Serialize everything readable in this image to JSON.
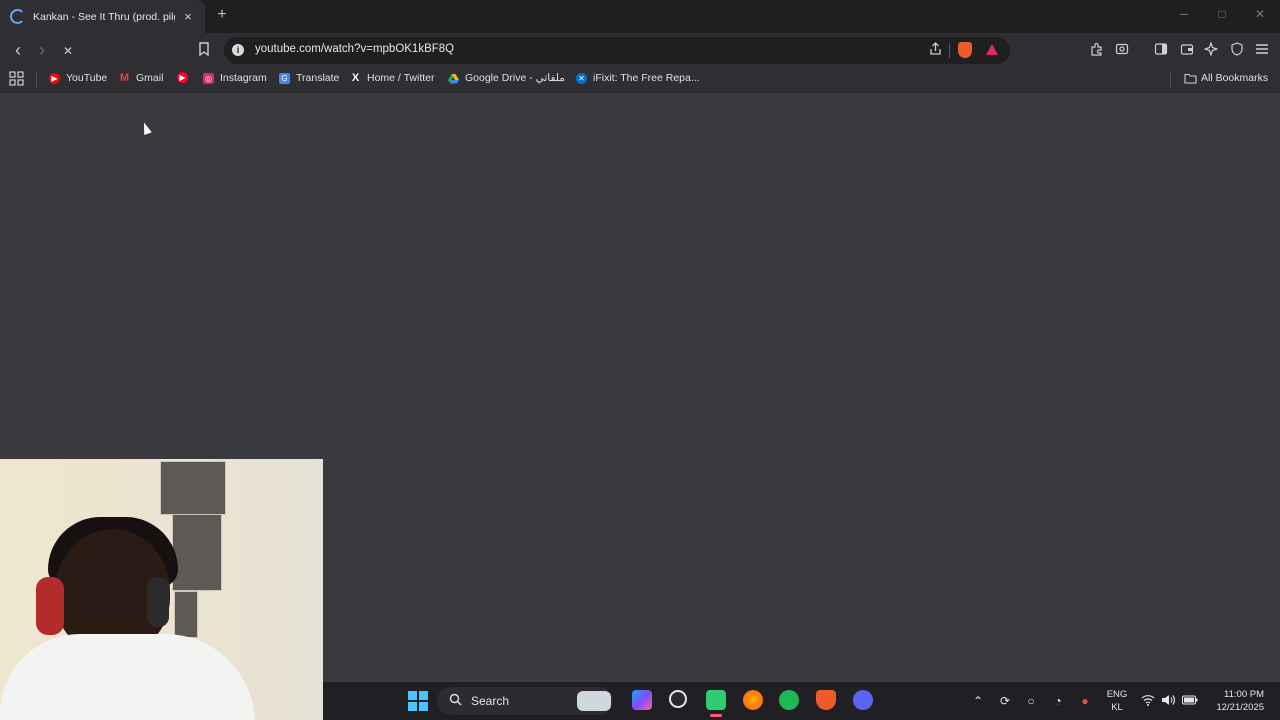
{
  "browser": {
    "tab": {
      "title": "Kankan - See It Thru (prod. pilgri",
      "close": "×"
    },
    "new_tab": "+",
    "window_controls": {
      "minimize": "─",
      "maximize": "□",
      "close": "✕"
    },
    "address": {
      "url": "youtube.com/watch?v=mpbOK1kBF8Q",
      "info_icon": "i"
    },
    "nav": {
      "back": "‹",
      "forward": "›",
      "stop": "✕"
    },
    "bookmarks": [
      {
        "label": "YouTube",
        "icon": "youtube-icon",
        "color": "#ff0000"
      },
      {
        "label": "Gmail",
        "icon": "gmail-icon",
        "color": "#ea4335"
      },
      {
        "label": "",
        "icon": "youtube-music-icon",
        "color": "#ff0033"
      },
      {
        "label": "Instagram",
        "icon": "instagram-icon",
        "color": "#d62976"
      },
      {
        "label": "Translate",
        "icon": "translate-icon",
        "color": "#4285f4"
      },
      {
        "label": "Home / Twitter",
        "icon": "x-icon",
        "color": "#000000"
      },
      {
        "label": "Google Drive - ملفاتي",
        "icon": "google-drive-icon",
        "color": "#1fa463"
      },
      {
        "label": "iFixit: The Free Repa...",
        "icon": "ifixit-icon",
        "color": "#0071ce"
      }
    ],
    "all_bookmarks": "All Bookmarks"
  },
  "taskbar": {
    "search_label": "Search",
    "language": {
      "line1": "ENG",
      "line2": "KL"
    },
    "clock": {
      "time": "11:00 PM",
      "date": "12/21/2025"
    }
  },
  "colors": {
    "page_bg": "#3a3a3f",
    "chrome_bg": "#2f2f33",
    "tabstrip_bg": "#1f1f22",
    "taskbar_bg": "#202024",
    "brave_orange": "#ef5a2a",
    "accent_blue": "#4cc2ff"
  }
}
